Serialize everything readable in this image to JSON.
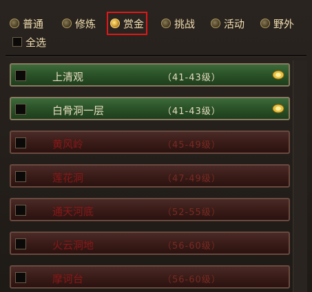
{
  "tabs": [
    {
      "label": "普通",
      "selected": false
    },
    {
      "label": "修炼",
      "selected": false
    },
    {
      "label": "赏金",
      "selected": true
    },
    {
      "label": "挑战",
      "selected": false
    },
    {
      "label": "活动",
      "selected": false
    },
    {
      "label": "野外",
      "selected": false
    }
  ],
  "select_all": {
    "label": "全选"
  },
  "dungeons": [
    {
      "name": "上清观",
      "level": "（41-43级）",
      "state": "available",
      "reward": "coin-icon"
    },
    {
      "name": "白骨洞一层",
      "level": "（41-43级）",
      "state": "available",
      "reward": "coin-icon"
    },
    {
      "name": "黄风岭",
      "level": "（45-49级）",
      "state": "locked"
    },
    {
      "name": "莲花洞",
      "level": "（47-49级）",
      "state": "locked"
    },
    {
      "name": "通天河底",
      "level": "（52-55级）",
      "state": "locked"
    },
    {
      "name": "火云洞地",
      "level": "（56-60级）",
      "state": "locked"
    },
    {
      "name": "摩诃台",
      "level": "（56-60级）",
      "state": "locked"
    }
  ],
  "colors": {
    "active_outline": "#e01818",
    "available_row": "#2a5228",
    "locked_row": "#3a1c18"
  }
}
